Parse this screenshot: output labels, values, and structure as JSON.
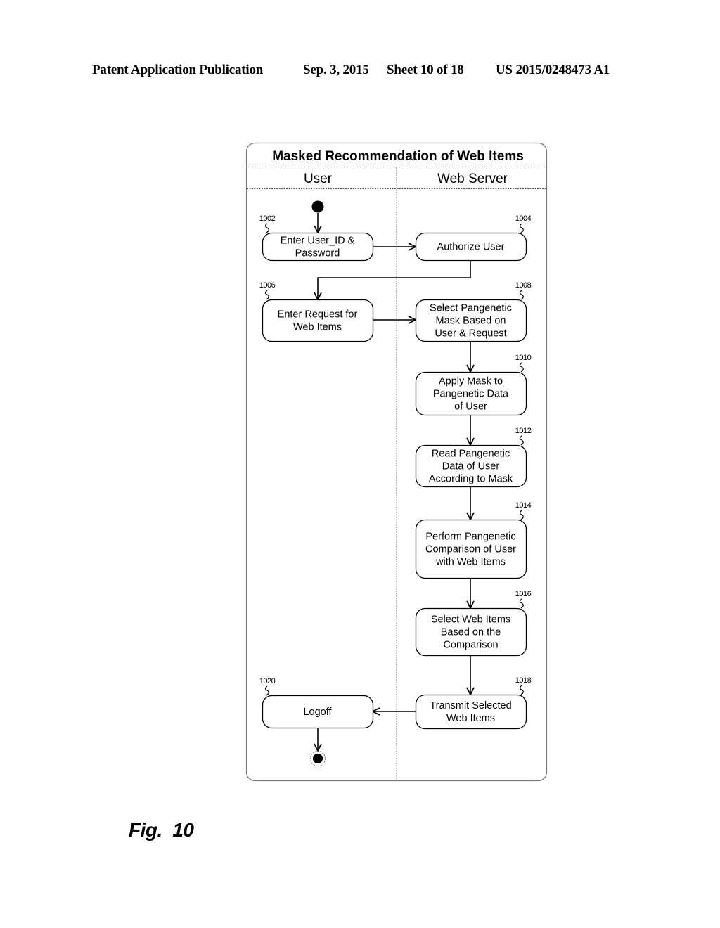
{
  "header": {
    "publication": "Patent Application Publication",
    "date": "Sep. 3, 2015",
    "sheet": "Sheet 10 of 18",
    "number": "US 2015/0248473 A1"
  },
  "diagram": {
    "title": "Masked Recommendation of Web Items",
    "lanes": [
      {
        "label": "User"
      },
      {
        "label": "Web Server"
      }
    ],
    "nodes": [
      {
        "id": "1002",
        "ref": "1002",
        "lane": "User",
        "lines": [
          "Enter User_ID &",
          "Password"
        ]
      },
      {
        "id": "1004",
        "ref": "1004",
        "lane": "Web Server",
        "lines": [
          "Authorize User"
        ]
      },
      {
        "id": "1006",
        "ref": "1006",
        "lane": "User",
        "lines": [
          "Enter Request for",
          "Web Items"
        ]
      },
      {
        "id": "1008",
        "ref": "1008",
        "lane": "Web Server",
        "lines": [
          "Select Pangenetic",
          "Mask Based on",
          "User & Request"
        ]
      },
      {
        "id": "1010",
        "ref": "1010",
        "lane": "Web Server",
        "lines": [
          "Apply Mask to",
          "Pangenetic Data",
          "of User"
        ]
      },
      {
        "id": "1012",
        "ref": "1012",
        "lane": "Web Server",
        "lines": [
          "Read Pangenetic",
          "Data of User",
          "According to Mask"
        ]
      },
      {
        "id": "1014",
        "ref": "1014",
        "lane": "Web Server",
        "lines": [
          "Perform Pangenetic",
          "Comparison of User",
          "with Web Items"
        ]
      },
      {
        "id": "1016",
        "ref": "1016",
        "lane": "Web Server",
        "lines": [
          "Select Web Items",
          "Based on the",
          "Comparison"
        ]
      },
      {
        "id": "1018",
        "ref": "1018",
        "lane": "Web Server",
        "lines": [
          "Transmit Selected",
          "Web Items"
        ]
      },
      {
        "id": "1020",
        "ref": "1020",
        "lane": "User",
        "lines": [
          "Logoff"
        ]
      }
    ],
    "edges": [
      {
        "from": "start",
        "to": "1002"
      },
      {
        "from": "1002",
        "to": "1004"
      },
      {
        "from": "1004",
        "to": "1006"
      },
      {
        "from": "1006",
        "to": "1008"
      },
      {
        "from": "1008",
        "to": "1010"
      },
      {
        "from": "1010",
        "to": "1012"
      },
      {
        "from": "1012",
        "to": "1014"
      },
      {
        "from": "1014",
        "to": "1016"
      },
      {
        "from": "1016",
        "to": "1018"
      },
      {
        "from": "1018",
        "to": "1020"
      },
      {
        "from": "1020",
        "to": "end"
      }
    ]
  },
  "figure_label": "Fig.  10"
}
